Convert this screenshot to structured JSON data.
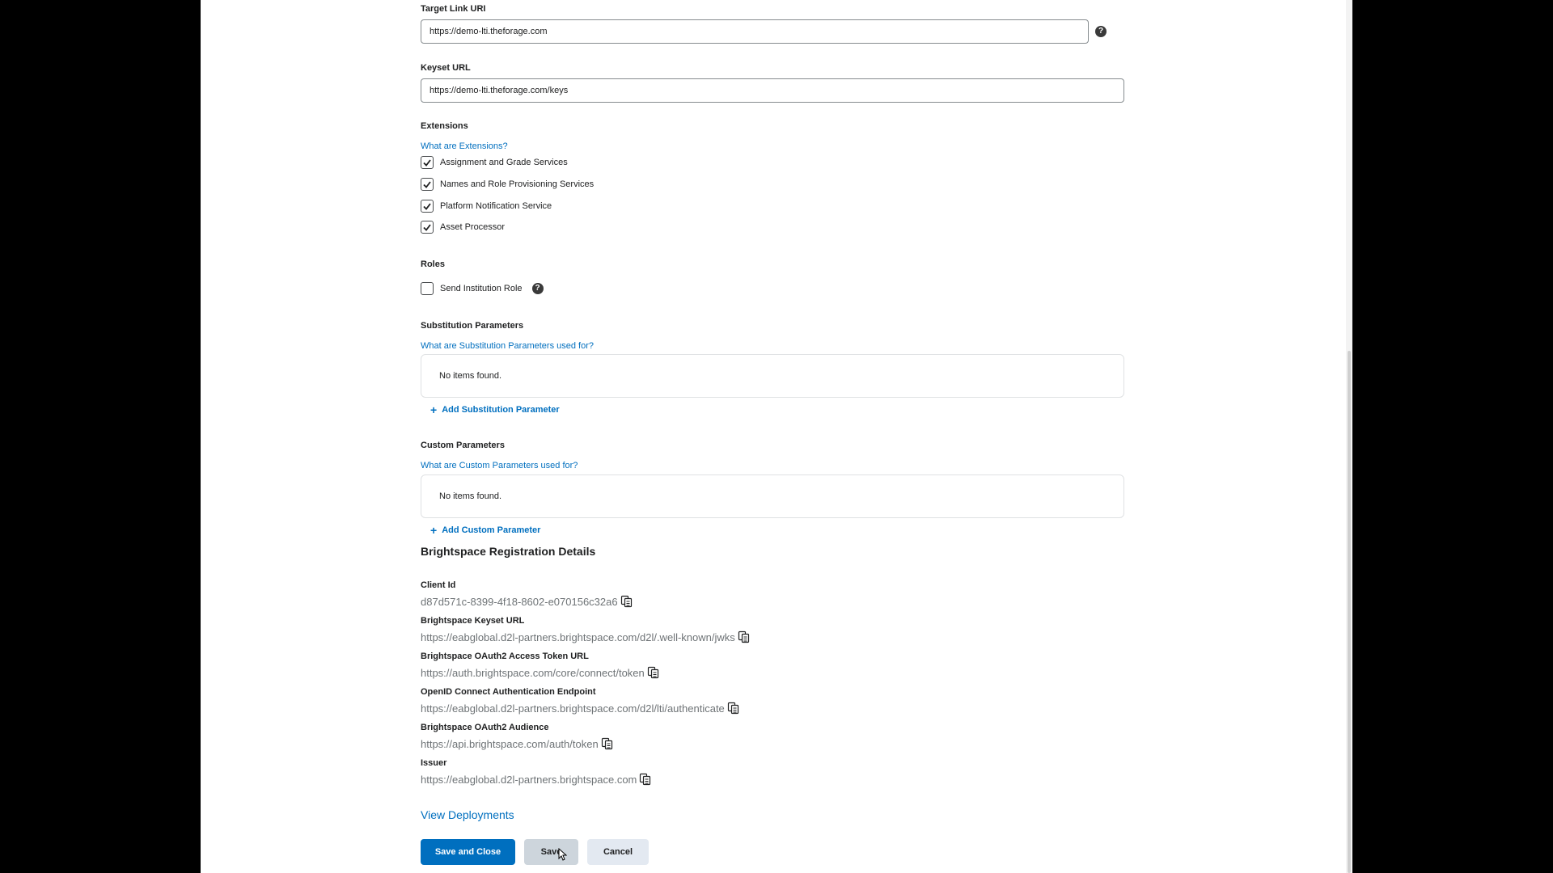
{
  "target_link": {
    "label": "Target Link URI",
    "value": "https://demo-lti.theforage.com"
  },
  "keyset": {
    "label": "Keyset URL",
    "value": "https://demo-lti.theforage.com/keys"
  },
  "extensions": {
    "label": "Extensions",
    "help_link": "What are Extensions?",
    "items": [
      {
        "label": "Assignment and Grade Services",
        "checked": true
      },
      {
        "label": "Names and Role Provisioning Services",
        "checked": true
      },
      {
        "label": "Platform Notification Service",
        "checked": true
      },
      {
        "label": "Asset Processor",
        "checked": true
      }
    ]
  },
  "roles": {
    "label": "Roles",
    "send_institution_role": "Send Institution Role",
    "checked": false
  },
  "substitution": {
    "label": "Substitution Parameters",
    "help_link": "What are Substitution Parameters used for?",
    "empty": "No items found.",
    "add": "Add Substitution Parameter"
  },
  "custom": {
    "label": "Custom Parameters",
    "help_link": "What are Custom Parameters used for?",
    "empty": "No items found.",
    "add": "Add Custom Parameter"
  },
  "registration": {
    "heading": "Brightspace Registration Details",
    "fields": [
      {
        "label": "Client Id",
        "value": "d87d571c-8399-4f18-8602-e070156c32a6"
      },
      {
        "label": "Brightspace Keyset URL",
        "value": "https://eabglobal.d2l-partners.brightspace.com/d2l/.well-known/jwks"
      },
      {
        "label": "Brightspace OAuth2 Access Token URL",
        "value": "https://auth.brightspace.com/core/connect/token"
      },
      {
        "label": "OpenID Connect Authentication Endpoint",
        "value": "https://eabglobal.d2l-partners.brightspace.com/d2l/lti/authenticate"
      },
      {
        "label": "Brightspace OAuth2 Audience",
        "value": "https://api.brightspace.com/auth/token"
      },
      {
        "label": "Issuer",
        "value": "https://eabglobal.d2l-partners.brightspace.com"
      }
    ]
  },
  "view_deployments": "View Deployments",
  "buttons": {
    "save_close": "Save and Close",
    "save": "Save",
    "cancel": "Cancel"
  },
  "colors": {
    "primary": "#006fbf",
    "link": "#006fbf",
    "secondary_bg": "#e3e9f1",
    "muted_text": "#6e7376"
  }
}
